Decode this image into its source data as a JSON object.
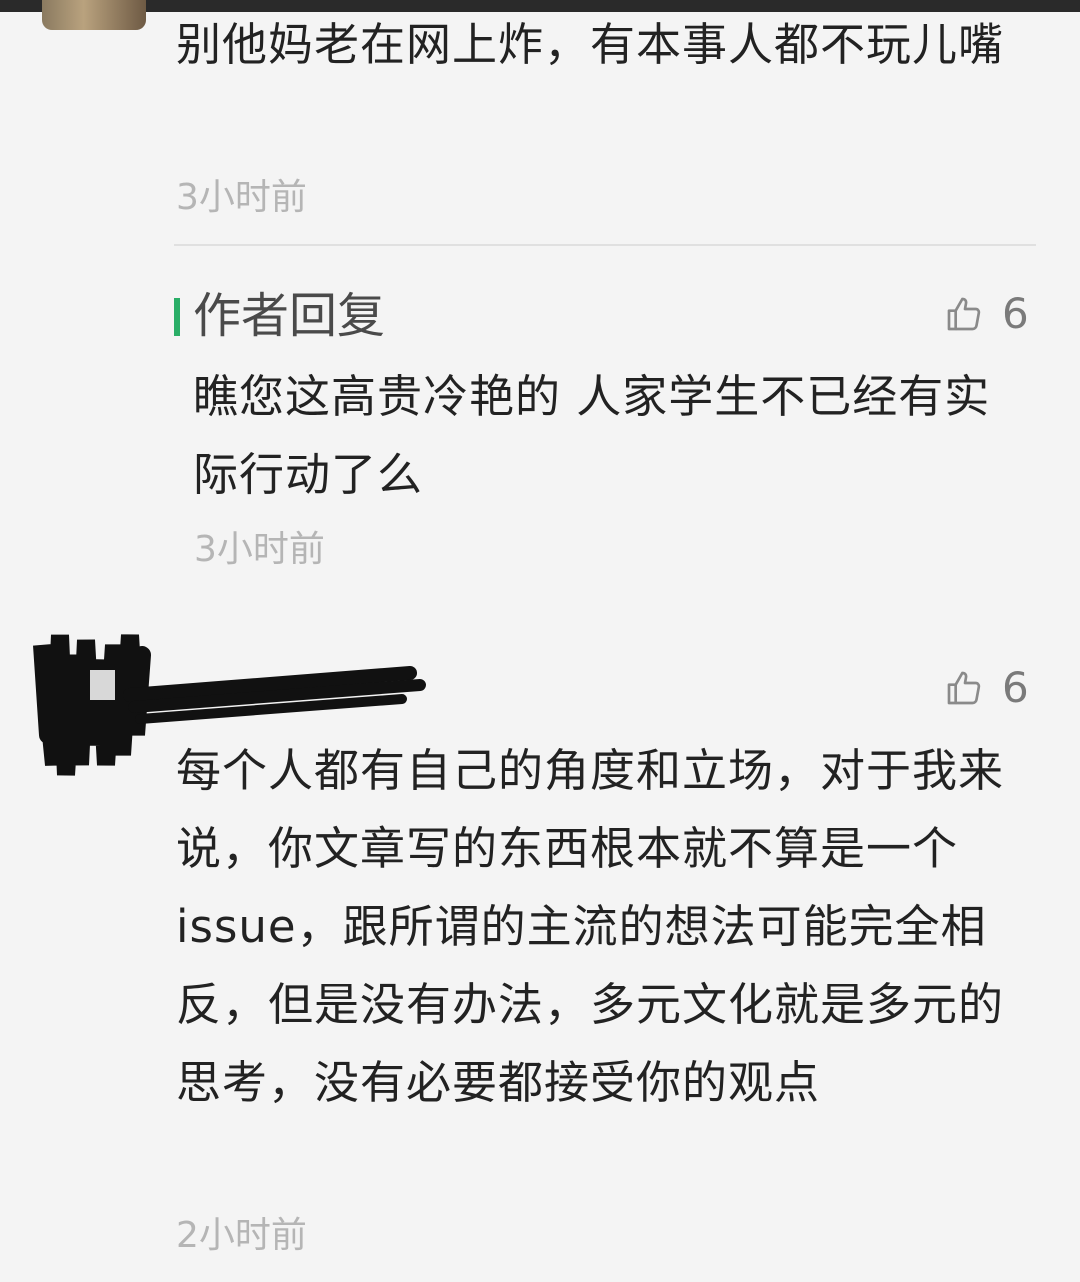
{
  "comments": [
    {
      "text": "别他妈老在网上炸，有本事人都不玩儿嘴",
      "time": "3小时前",
      "author_reply": {
        "label": "作者回复",
        "likes": "6",
        "text": "瞧您这高贵冷艳的 人家学生不已经有实际行动了么",
        "time": "3小时前"
      }
    },
    {
      "likes": "6",
      "text": "每个人都有自己的角度和立场，对于我来说，你文章写的东西根本就不算是一个issue，跟所谓的主流的想法可能完全相反，但是没有办法，多元文化就是多元的思考，没有必要都接受你的观点",
      "time": "2小时前"
    }
  ],
  "colors": {
    "reply_accent": "#2aae67",
    "timestamp": "#b5b5b5",
    "like_icon": "#8a8a8a"
  },
  "icons": {
    "like": "thumbs-up-icon"
  }
}
